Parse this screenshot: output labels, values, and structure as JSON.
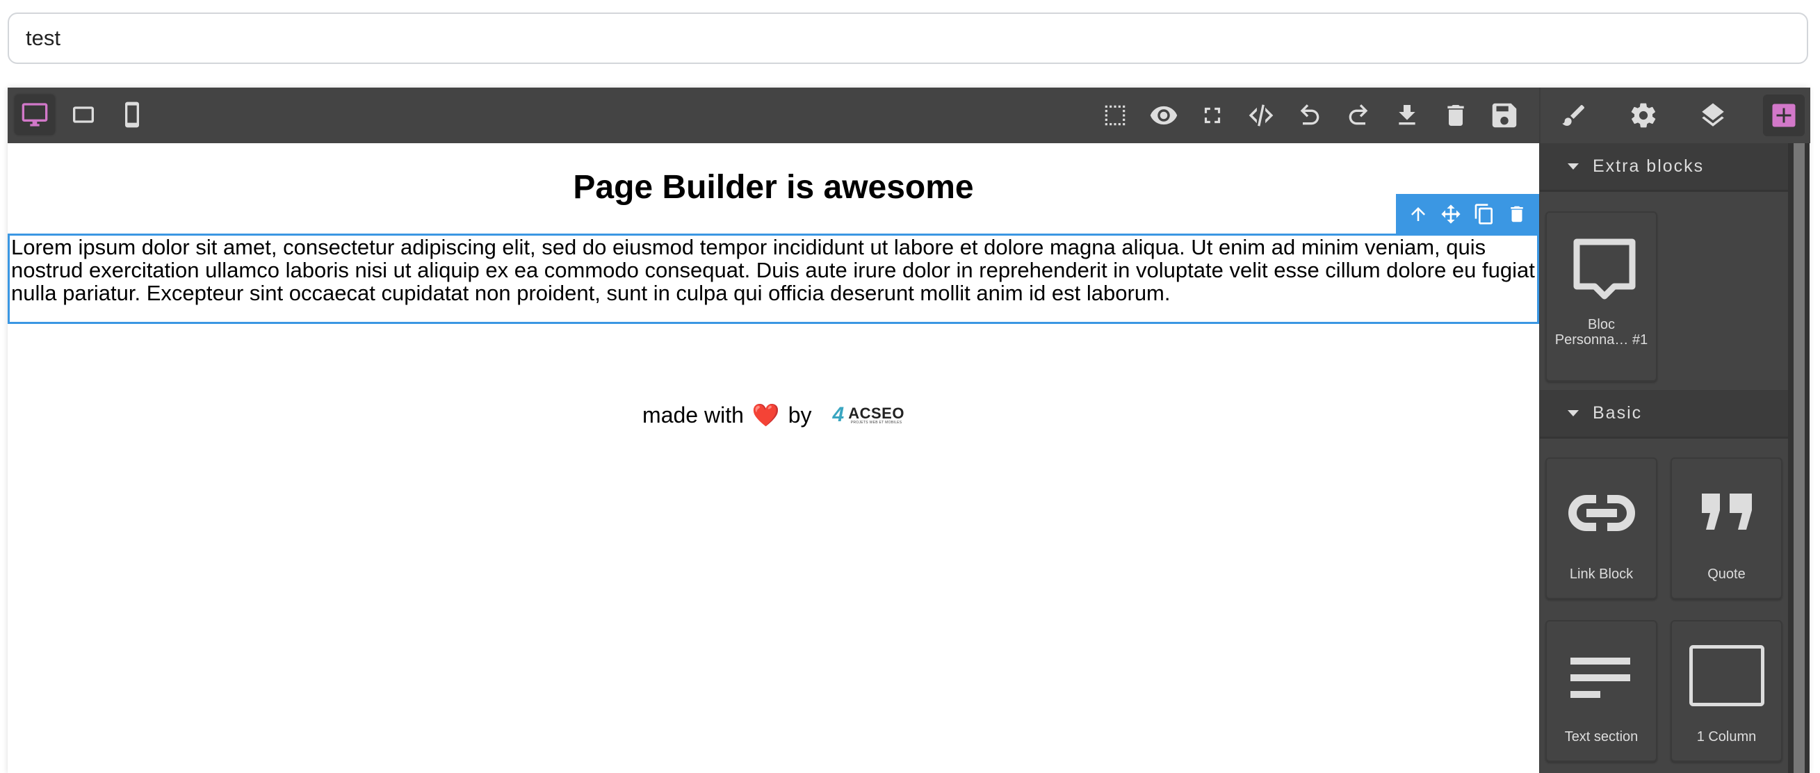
{
  "title_input": {
    "value": "test"
  },
  "toolbar": {
    "devices": [
      {
        "id": "desktop",
        "icon": "desktop-icon",
        "active": true
      },
      {
        "id": "tablet",
        "icon": "tablet-icon",
        "active": false
      },
      {
        "id": "mobile",
        "icon": "mobile-icon",
        "active": false
      }
    ],
    "options": [
      "sw-visibility-icon",
      "preview-icon",
      "fullscreen-icon",
      "export-code-icon",
      "undo-icon",
      "redo-icon",
      "download-icon",
      "clear-canvas-icon",
      "save-icon"
    ],
    "views": [
      "style-manager-icon",
      "settings-icon",
      "layer-manager-icon",
      "open-blocks-icon"
    ],
    "accent_color": "#d278c9"
  },
  "canvas": {
    "heading": "Page Builder is awesome",
    "paragraph": "Lorem ipsum dolor sit amet, consectetur adipiscing elit, sed do eiusmod tempor incididunt ut labore et dolore magna aliqua. Ut enim ad minim veniam, quis nostrud exercitation ullamco laboris nisi ut aliquip ex ea commodo consequat. Duis aute irure dolor in reprehenderit in voluptate velit esse cillum dolore eu fugiat nulla pariatur. Excepteur sint occaecat cupidatat non proident, sunt in culpa qui officia deserunt mollit anim id est laborum.",
    "selection_color": "#3b97e3",
    "selection_toolbar": [
      "select-parent-icon",
      "move-icon",
      "clone-icon",
      "delete-icon"
    ],
    "footer": {
      "prefix": "made with",
      "heart": "❤️",
      "suffix": "by",
      "logo_mark": "4",
      "logo_name": "ACSEO",
      "logo_tagline": "PROJETS WEB ET MOBILES"
    }
  },
  "blocks_panel": {
    "categories": [
      {
        "label": "Extra blocks",
        "blocks": [
          {
            "label": "Bloc Personna… #1",
            "icon": "speech-bubble-icon"
          }
        ]
      },
      {
        "label": "Basic",
        "blocks": [
          {
            "label": "Link Block",
            "icon": "link-icon"
          },
          {
            "label": "Quote",
            "icon": "quote-icon"
          },
          {
            "label": "Text section",
            "icon": "text-section-icon"
          },
          {
            "label": "1 Column",
            "icon": "column-icon"
          }
        ]
      }
    ]
  }
}
